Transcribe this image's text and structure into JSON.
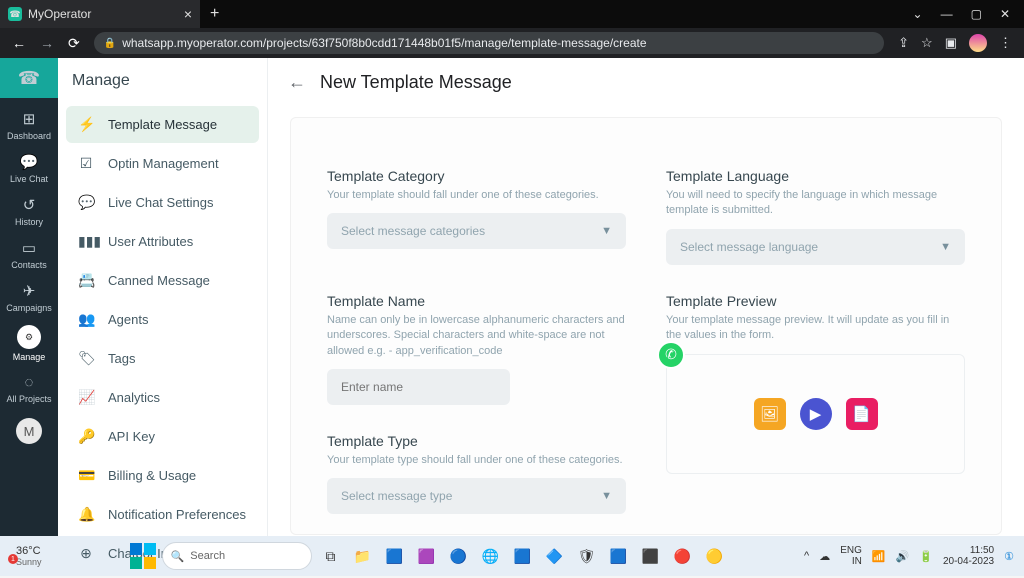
{
  "browser": {
    "tab_title": "MyOperator",
    "url": "whatsapp.myoperator.com/projects/63f750f8b0cdd171448b01f5/manage/template-message/create"
  },
  "iconbar": {
    "items": [
      "Dashboard",
      "Live Chat",
      "History",
      "Contacts",
      "Campaigns",
      "Manage",
      "All Projects"
    ],
    "active_index": 5,
    "avatar_letter": "M"
  },
  "sidebar": {
    "title": "Manage",
    "items": [
      {
        "icon": "⚡",
        "label": "Template Message",
        "active": true
      },
      {
        "icon": "☑",
        "label": "Optin Management"
      },
      {
        "icon": "💬",
        "label": "Live Chat Settings"
      },
      {
        "icon": "▮▮▮",
        "label": "User Attributes"
      },
      {
        "icon": "📇",
        "label": "Canned Message"
      },
      {
        "icon": "👥",
        "label": "Agents"
      },
      {
        "icon": "🏷",
        "label": "Tags"
      },
      {
        "icon": "📈",
        "label": "Analytics"
      },
      {
        "icon": "🔑",
        "label": "API Key"
      },
      {
        "icon": "💳",
        "label": "Billing & Usage"
      },
      {
        "icon": "🔔",
        "label": "Notification Preferences"
      },
      {
        "icon": "⊕",
        "label": "Chatbot Integration"
      }
    ]
  },
  "page": {
    "title": "New Template Message",
    "category": {
      "label": "Template Category",
      "help": "Your template should fall under one of these categories.",
      "placeholder": "Select message categories"
    },
    "language": {
      "label": "Template Language",
      "help": "You will need to specify the language in which message template is submitted.",
      "placeholder": "Select message language"
    },
    "name": {
      "label": "Template Name",
      "help": "Name can only be in lowercase alphanumeric characters and underscores. Special characters and white-space are not allowed e.g. - app_verification_code",
      "placeholder": "Enter name"
    },
    "type": {
      "label": "Template Type",
      "help": "Your template type should fall under one of these categories.",
      "placeholder": "Select message type"
    },
    "preview": {
      "label": "Template Preview",
      "help": "Your template message preview. It will update as you fill in the values in the form."
    }
  },
  "taskbar": {
    "weather_temp": "36°C",
    "weather_label": "Sunny",
    "search_placeholder": "Search",
    "lang1": "ENG",
    "lang2": "IN",
    "time": "11:50",
    "date": "20-04-2023"
  }
}
